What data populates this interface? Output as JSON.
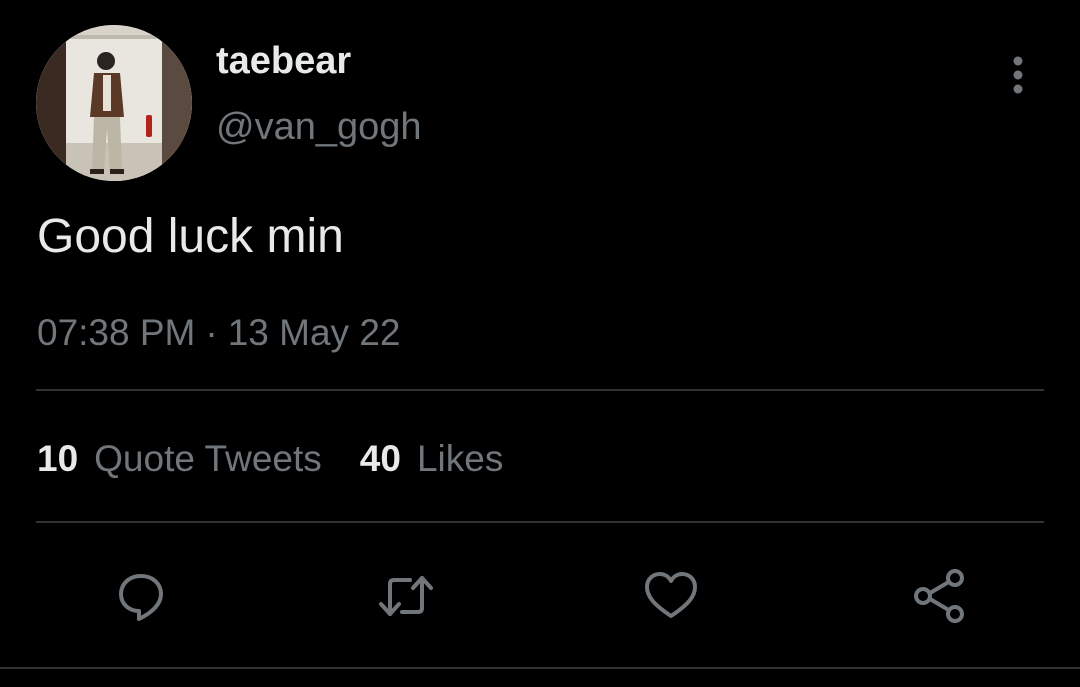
{
  "tweet": {
    "author": {
      "display_name": "taebear",
      "handle": "@van_gogh",
      "avatar": "profile-photo"
    },
    "text": "Good luck min",
    "time": "07:38 PM",
    "separator": "·",
    "date": "13 May 22",
    "stats": {
      "quote_tweets_count": "10",
      "quote_tweets_label": "Quote Tweets",
      "likes_count": "40",
      "likes_label": "Likes"
    },
    "actions": [
      {
        "name": "reply",
        "icon": "speech-bubble-icon"
      },
      {
        "name": "retweet",
        "icon": "retweet-arrows-icon"
      },
      {
        "name": "like",
        "icon": "heart-icon"
      },
      {
        "name": "share",
        "icon": "share-nodes-icon"
      }
    ]
  },
  "colors": {
    "background": "#000000",
    "primary_text": "#e7e9ea",
    "secondary_text": "#71767b",
    "divider": "#2f3336"
  }
}
